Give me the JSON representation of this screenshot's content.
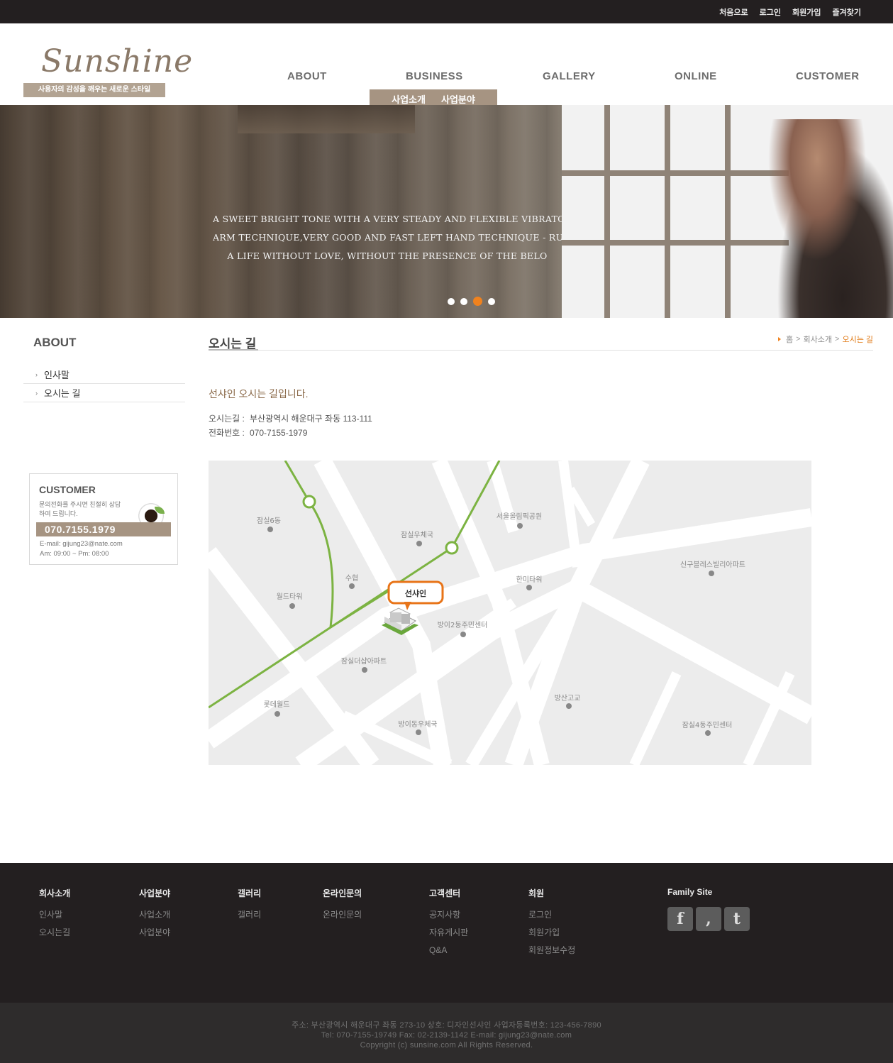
{
  "topbar": {
    "links": [
      "처음으로",
      "로그인",
      "회원가입",
      "즐겨찾기"
    ]
  },
  "header": {
    "logo": "Sunshine",
    "tagline": "사용자의 감성을 깨우는 새로운 스타일",
    "nav": [
      "ABOUT",
      "BUSINESS",
      "GALLERY",
      "ONLINE",
      "CUSTOMER"
    ],
    "subnav": [
      "사업소개",
      "사업분야"
    ]
  },
  "hero": {
    "lines": [
      "A SWEET BRIGHT TONE WITH A VERY STEADY AND FLEXIBLE VIBRATO,",
      "ARM TECHNIQUE,VERY GOOD AND FAST LEFT HAND TECHNIQUE - RUDOLF K",
      "A LIFE WITHOUT LOVE, WITHOUT THE PRESENCE OF THE BELO"
    ],
    "slides": 4,
    "active_slide": 3
  },
  "sidebar": {
    "title": "ABOUT",
    "items": [
      "인사말",
      "오시는 길"
    ],
    "customer": {
      "title": "CUSTOMER",
      "desc": "문의전화를 주시면 친절히 상담하여 드립니다.",
      "phone": "070.7155.1979",
      "email": "E-mail: gijung23@nate.com",
      "hours": "Am: 09:00 ~ Pm: 08:00"
    }
  },
  "content": {
    "title": "오시는 길",
    "breadcrumb": [
      "홈",
      "회사소개",
      "오시는 길"
    ],
    "intro": "선샤인 오시는 길입니다.",
    "address_label": "오시는길 :",
    "address": "부산광역시 해운대구 좌동 113-111",
    "phone_label": "전화번호 :",
    "phone": "070-7155-1979"
  },
  "map": {
    "marker": "선샤인",
    "places": [
      "잠실6동",
      "잠실우체국",
      "서울올림픽공원",
      "신구블레스빌리아파트",
      "수협",
      "한미타워",
      "월드타워",
      "방이2동주민센터",
      "잠실더샵아파트",
      "롯데월드",
      "방산고교",
      "방이동우체국",
      "잠실4동주민센터"
    ]
  },
  "footer": {
    "columns": [
      {
        "title": "회사소개",
        "links": [
          "인사말",
          "오시는길"
        ]
      },
      {
        "title": "사업분야",
        "links": [
          "사업소개",
          "사업분야"
        ]
      },
      {
        "title": "갤러리",
        "links": [
          "갤러리"
        ]
      },
      {
        "title": "온라인문의",
        "links": [
          "온라인문의"
        ]
      },
      {
        "title": "고객센터",
        "links": [
          "공지사항",
          "자유게시판",
          "Q&A"
        ]
      },
      {
        "title": "회원",
        "links": [
          "로그인",
          "회원가입",
          "회원정보수정"
        ]
      }
    ],
    "family_title": "Family Site",
    "copy": [
      "주소: 부산광역시 해운대구 좌동 273-10  상호: 디자인선샤인  사업자등록번호: 123-456-7890",
      "Tel: 070-7155-19749  Fax: 02-2139-1142  E-mail: gijung23@nate.com",
      "Copyright (c) sunsine.com All Rights Reserved."
    ]
  },
  "colors": {
    "accent": "#f0821e",
    "brand": "#a69482",
    "dark": "#231f20",
    "route": "#7cb342"
  },
  "icons": [
    "facebook-icon",
    "blog-icon",
    "twitter-icon",
    "tea-cup-icon",
    "building-icon"
  ]
}
